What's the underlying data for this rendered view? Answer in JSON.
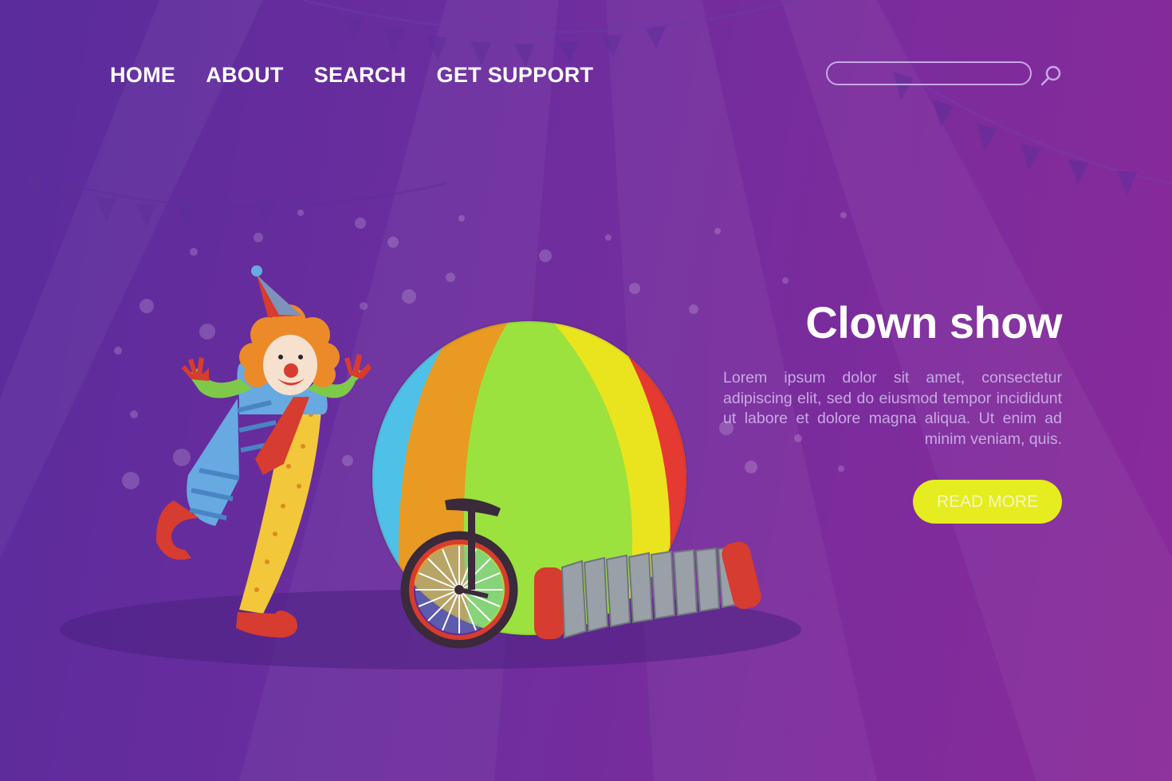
{
  "nav": {
    "items": [
      {
        "label": "HOME"
      },
      {
        "label": "ABOUT"
      },
      {
        "label": "SEARCH"
      },
      {
        "label": "GET SUPPORT"
      }
    ]
  },
  "search": {
    "placeholder": "",
    "value": "",
    "icon": "search-icon"
  },
  "hero": {
    "title": "Clown show",
    "body": "Lorem ipsum dolor sit amet, consectetur adipiscing elit, sed do eiusmod tempor incididunt ut labore et dolore magna aliqua. Ut enim ad minim veniam, quis.",
    "cta_label": "READ MORE"
  },
  "colors": {
    "background_start": "#5a2c9c",
    "background_end": "#8a2a9a",
    "cta": "#e5ec1f",
    "text": "#ffffff",
    "body_text": "#c7a9e3"
  }
}
